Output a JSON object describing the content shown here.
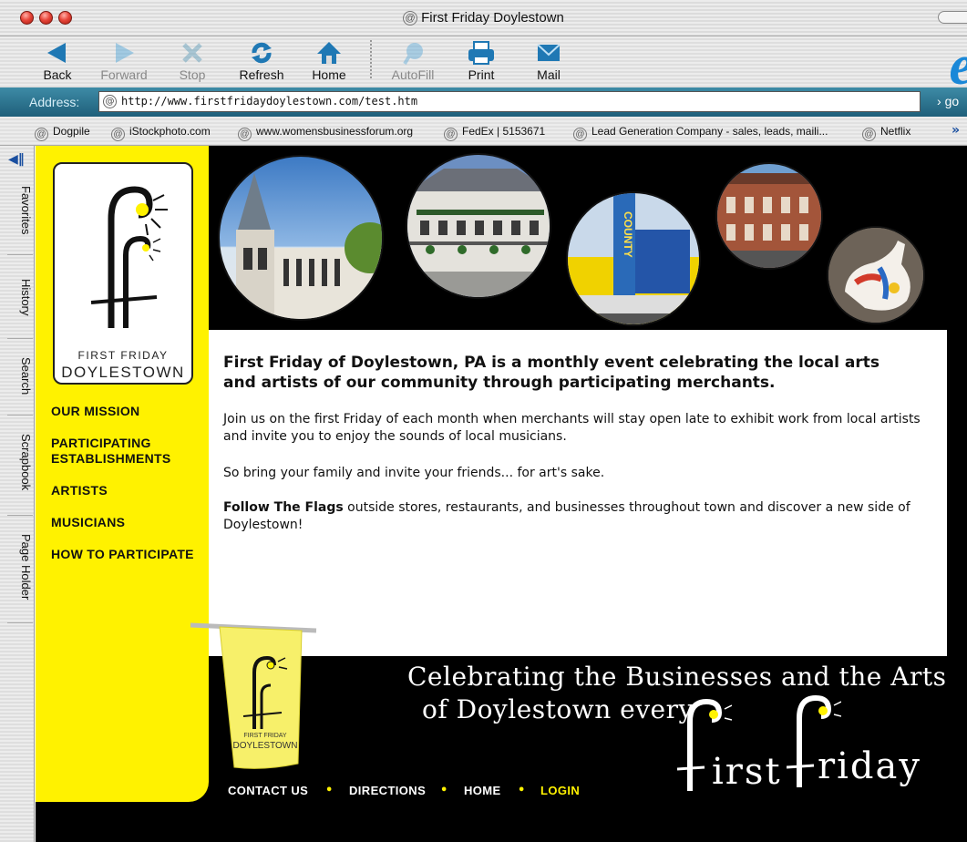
{
  "window": {
    "title": "First Friday Doylestown"
  },
  "toolbar": {
    "back": "Back",
    "forward": "Forward",
    "stop": "Stop",
    "refresh": "Refresh",
    "home": "Home",
    "autofill": "AutoFill",
    "print": "Print",
    "mail": "Mail"
  },
  "address": {
    "label": "Address:",
    "url": "http://www.firstfridaydoylestown.com/test.htm",
    "go": "go"
  },
  "favorites": [
    "Dogpile",
    "iStockphoto.com",
    "www.womensbusinessforum.org",
    "FedEx | 5153671",
    "Lead Generation Company - sales, leads, maili...",
    "Netflix"
  ],
  "explorer_tabs": [
    "Favorites",
    "History",
    "Search",
    "Scrapbook",
    "Page Holder"
  ],
  "site": {
    "logo_small": "FIRST FRIDAY",
    "logo_big": "DOYLESTOWN",
    "nav": [
      "OUR MISSION",
      "PARTICIPATING ESTABLISHMENTS",
      "ARTISTS",
      "MUSICIANS",
      "HOW TO PARTICIPATE"
    ],
    "headline": "First Friday of Doylestown, PA is a monthly event celebrating the local arts and artists of our community through participating merchants.",
    "para1": "Join us on the first Friday of each month when merchants will stay open late to exhibit work from local artists and invite you to enjoy the sounds of local musicians.",
    "para2": "So bring your family and invite your friends... for art's sake.",
    "para3_bold": "Follow The Flags",
    "para3_rest": " outside stores, restaurants, and businesses throughout town and discover a new side of Doylestown!",
    "flag_small": "FIRST FRIDAY",
    "flag_big": "DOYLESTOWN",
    "banner_line1": "Celebrating the Businesses and the Arts",
    "banner_line2": "of Doylestown every",
    "banner_word1": "irst",
    "banner_word2": "riday",
    "footer": [
      "CONTACT US",
      "DIRECTIONS",
      "HOME",
      "LOGIN"
    ],
    "footer_sep": "•"
  },
  "colors": {
    "brand_yellow": "#fff200",
    "address_bar": "#2c7590",
    "link_login": "#fff200"
  }
}
